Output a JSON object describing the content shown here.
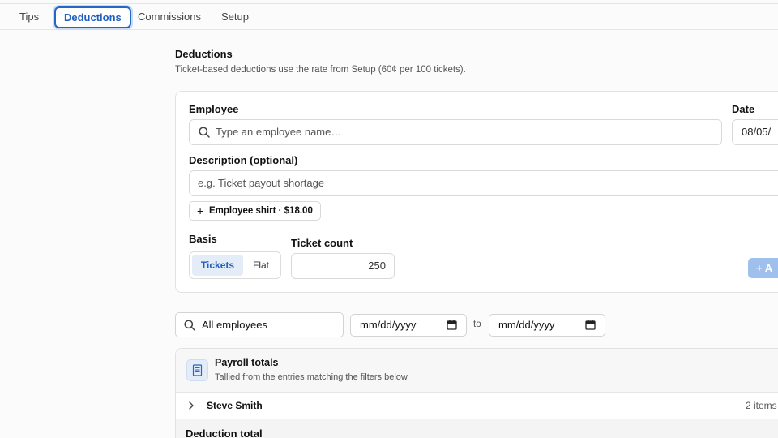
{
  "tabs": [
    {
      "label": "Tips"
    },
    {
      "label": "Deductions"
    },
    {
      "label": "Commissions"
    },
    {
      "label": "Setup"
    }
  ],
  "active_tab": "Deductions",
  "section": {
    "title": "Deductions",
    "subtitle": "Ticket-based deductions use the rate from Setup (60¢ per 100 tickets)."
  },
  "form": {
    "employee_label": "Employee",
    "employee_placeholder": "Type an employee name…",
    "date_label": "Date",
    "date_value": "08/05/",
    "description_label": "Description (optional)",
    "description_placeholder": "e.g. Ticket payout shortage",
    "quick_chip": "Employee shirt · $18.00",
    "basis_label": "Basis",
    "basis_options": [
      "Tickets",
      "Flat"
    ],
    "basis_selected": "Tickets",
    "ticket_count_label": "Ticket count",
    "ticket_count_value": "250",
    "add_label": "A"
  },
  "filters": {
    "employee_filter": "All employees",
    "date_from_placeholder": "mm/dd/yyyy",
    "to_label": "to",
    "date_to_placeholder": "mm/dd/yyyy"
  },
  "totals": {
    "title": "Payroll totals",
    "subtitle": "Tallied from the entries matching the filters below",
    "rows": [
      {
        "name": "Steve Smith",
        "count": "2 items"
      }
    ],
    "total_label": "Deduction total"
  },
  "colors": {
    "accent": "#2566c9",
    "accent_soft": "#e4ecf8",
    "add_button_disabled": "#9fbfec"
  }
}
